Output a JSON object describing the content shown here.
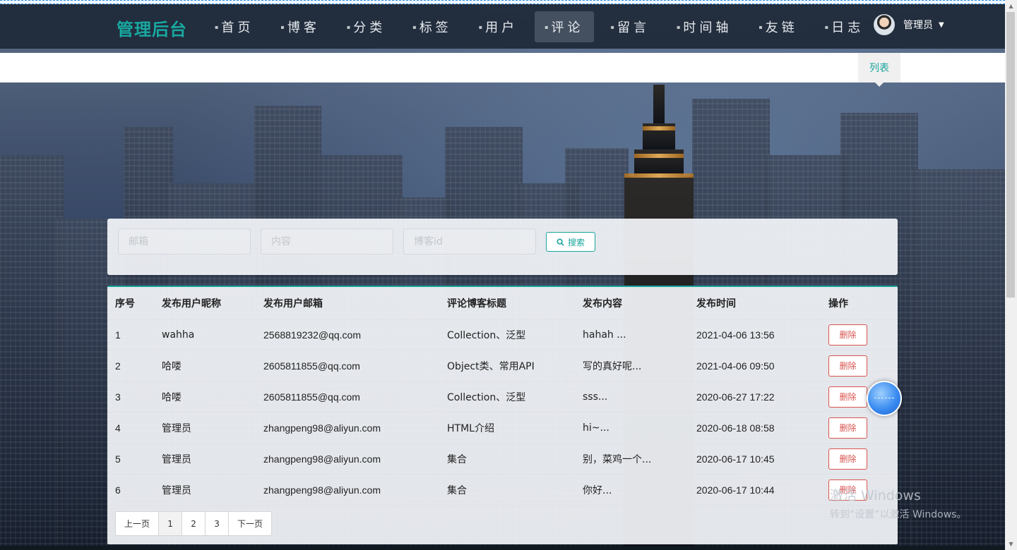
{
  "brand": {
    "title": "管理后台"
  },
  "nav": {
    "items": [
      {
        "label": "首页",
        "active": false
      },
      {
        "label": "博客",
        "active": false
      },
      {
        "label": "分类",
        "active": false
      },
      {
        "label": "标签",
        "active": false
      },
      {
        "label": "用户",
        "active": false
      },
      {
        "label": "评论",
        "active": true
      },
      {
        "label": "留言",
        "active": false
      },
      {
        "label": "时间轴",
        "active": false
      },
      {
        "label": "友链",
        "active": false
      },
      {
        "label": "日志",
        "active": false
      }
    ],
    "user": {
      "name": "管理员",
      "avatar_icon": "user-avatar"
    }
  },
  "subnav": {
    "tab_label": "列表"
  },
  "search": {
    "email_placeholder": "邮箱",
    "content_placeholder": "内容",
    "blog_id_placeholder": "博客id",
    "button_label": "搜索",
    "button_icon": "search-icon"
  },
  "table": {
    "columns": [
      "序号",
      "发布用户昵称",
      "发布用户邮箱",
      "评论博客标题",
      "发布内容",
      "发布时间",
      "操作"
    ],
    "rows": [
      {
        "index": "1",
        "nickname": "wahha",
        "email": "2568819232@qq.com",
        "blog_title": "Collection、泛型",
        "content": "hahah ...",
        "time": "2021-04-06 13:56",
        "action": "删除"
      },
      {
        "index": "2",
        "nickname": "哈喽",
        "email": "2605811855@qq.com",
        "blog_title": "Object类、常用API",
        "content": "写的真好呢...",
        "time": "2021-04-06 09:50",
        "action": "删除"
      },
      {
        "index": "3",
        "nickname": "哈喽",
        "email": "2605811855@qq.com",
        "blog_title": "Collection、泛型",
        "content": "sss...",
        "time": "2020-06-27 17:22",
        "action": "删除"
      },
      {
        "index": "4",
        "nickname": "管理员",
        "email": "zhangpeng98@aliyun.com",
        "blog_title": "HTML介绍",
        "content": "hi~...",
        "time": "2020-06-18 08:58",
        "action": "删除"
      },
      {
        "index": "5",
        "nickname": "管理员",
        "email": "zhangpeng98@aliyun.com",
        "blog_title": "集合",
        "content": "别，菜鸡一个...",
        "time": "2020-06-17 10:45",
        "action": "删除"
      },
      {
        "index": "6",
        "nickname": "管理员",
        "email": "zhangpeng98@aliyun.com",
        "blog_title": "集合",
        "content": "你好...",
        "time": "2020-06-17 10:44",
        "action": "删除"
      }
    ]
  },
  "pagination": {
    "prev": "上一页",
    "pages": [
      "1",
      "2",
      "3"
    ],
    "current": "1",
    "next": "下一页"
  },
  "watermark": {
    "line1": "激活 Windows",
    "line2": "转到“设置”以激活 Windows。"
  },
  "colors": {
    "accent": "#1aa59d",
    "danger": "#d9534f",
    "navbar": "#1e2938"
  }
}
